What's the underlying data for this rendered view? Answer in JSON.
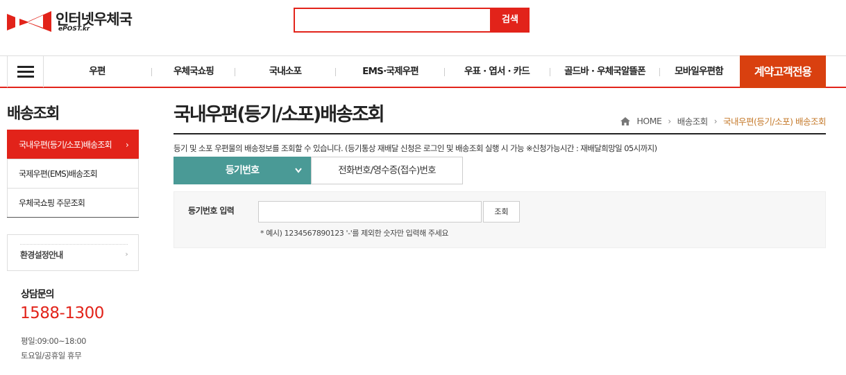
{
  "logo": {
    "title": "인터넷우체국",
    "subtitle": "ePOST.kr"
  },
  "search": {
    "value": "",
    "placeholder": "",
    "button_label": "검색"
  },
  "gnb": {
    "items": [
      "우편",
      "우체국쇼핑",
      "국내소포",
      "EMS·국제우편",
      "우표 · 엽서 · 카드",
      "골드바 · 우체국알뜰폰",
      "모바일우편함"
    ],
    "special": "계약고객전용"
  },
  "lnb": {
    "title": "배송조회",
    "items": [
      {
        "label": "국내우편(등기/소포)배송조회",
        "active": true,
        "arrow": "›"
      },
      {
        "label": "국제우편(EMS)배송조회",
        "active": false
      },
      {
        "label": "우체국쇼핑 주문조회",
        "active": false
      }
    ],
    "env_label": "환경설정안내",
    "env_arrow": "›"
  },
  "contact": {
    "label": "상담문의",
    "phone": "1588-1300",
    "hours_weekday": "평일:09:00~18:00",
    "hours_holiday": "토요일/공휴일 휴무"
  },
  "page": {
    "title": "국내우편(등기/소포)배송조회",
    "breadcrumb": {
      "home": "HOME",
      "parent": "배송조회",
      "current": "국내우편(등기/소포) 배송조회"
    },
    "description": "등기 및 소포 우편물의 배송정보를 조회할 수 있습니다. (등기통상 재배달 신청은 로그인 및 배송조회 실행 시 가능 ※신청가능시간 : 재배달희망일 05시까지)"
  },
  "tabs": {
    "active": "등기번호",
    "other": "전화번호/영수증(접수)번호"
  },
  "form": {
    "label": "등기번호 입력",
    "value": "",
    "button": "조회",
    "hint": "* 예시) 1234567890123 '-'를 제외한 숫자만 입력해 주세요"
  },
  "colors": {
    "accent_red": "#e2231a",
    "special_orange": "#d9400f",
    "tab_teal": "#4a9a96",
    "breadcrumb_current": "#c57a2b"
  }
}
